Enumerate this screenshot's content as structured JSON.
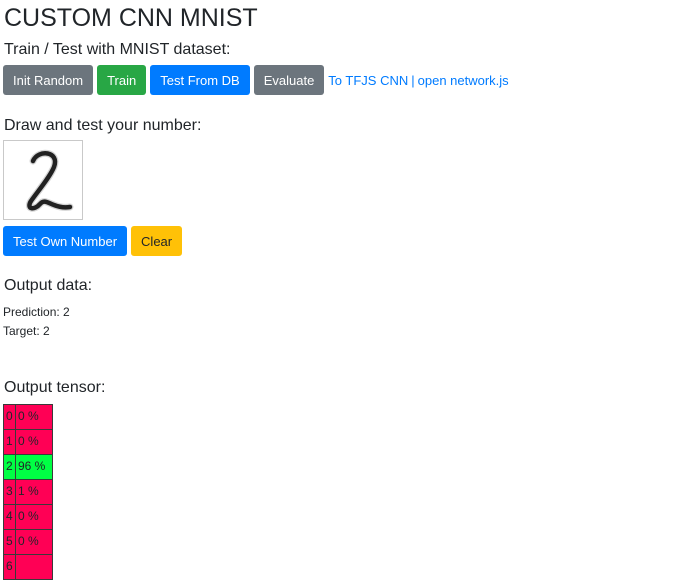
{
  "page": {
    "title": "CUSTOM CNN MNIST",
    "train_test_heading": "Train / Test with MNIST dataset:",
    "draw_heading": "Draw and test your number:",
    "output_data_heading": "Output data:",
    "output_tensor_heading": "Output tensor:"
  },
  "toolbar": {
    "init_random_label": "Init Random",
    "train_label": "Train",
    "test_from_db_label": "Test From DB",
    "evaluate_label": "Evaluate",
    "tfjs_link": "To TFJS CNN",
    "separator": "|",
    "open_network_link": "open network.js"
  },
  "draw": {
    "test_own_label": "Test Own Number",
    "clear_label": "Clear"
  },
  "output": {
    "prediction": "Prediction: 2",
    "target": "Target: 2"
  },
  "tensor": {
    "colors": {
      "low": "#ff0055",
      "high": "#00ff44"
    },
    "rows": [
      {
        "index": "0",
        "value": "0 %",
        "level": "low"
      },
      {
        "index": "1",
        "value": "0 %",
        "level": "low"
      },
      {
        "index": "2",
        "value": "96 %",
        "level": "high"
      },
      {
        "index": "3",
        "value": "1 %",
        "level": "low"
      },
      {
        "index": "4",
        "value": "0 %",
        "level": "low"
      },
      {
        "index": "5",
        "value": "0 %",
        "level": "low"
      },
      {
        "index": "6",
        "value": "",
        "level": "low"
      }
    ]
  }
}
